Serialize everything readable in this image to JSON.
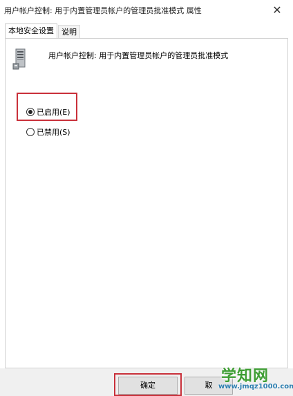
{
  "window": {
    "title": "用户帐户控制: 用于内置管理员帐户的管理员批准模式 属性",
    "close_glyph": "✕"
  },
  "tabs": [
    {
      "label": "本地安全设置",
      "active": true
    },
    {
      "label": "说明",
      "active": false
    }
  ],
  "policy": {
    "icon": "server-icon",
    "name": "用户帐户控制: 用于内置管理员帐户的管理员批准模式"
  },
  "options": {
    "enabled_label": "已启用(E)",
    "disabled_label": "已禁用(S)",
    "selected": "enabled"
  },
  "buttons": {
    "ok_label": "确定",
    "cancel_label": "取"
  },
  "watermark": {
    "title": "学知网",
    "url": "www.jmqz1000.com"
  },
  "colors": {
    "highlight": "#c9303a",
    "watermark_green": "#3f9e34",
    "watermark_blue": "#2e7fb0"
  }
}
